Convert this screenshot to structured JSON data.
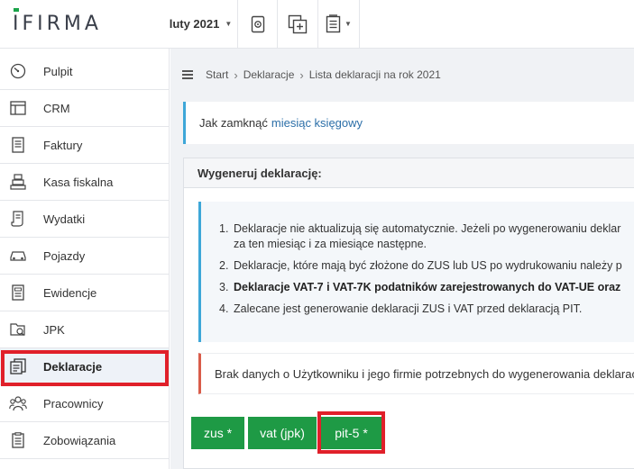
{
  "header": {
    "logo_prefix": "I",
    "logo_rest": "FIRMA",
    "month_label": "luty 2021",
    "toolbar_icons": [
      "register-icon",
      "add-document-icon",
      "document-list-icon"
    ]
  },
  "sidebar": {
    "items": [
      {
        "label": "Pulpit",
        "icon": "dashboard-icon"
      },
      {
        "label": "CRM",
        "icon": "crm-icon"
      },
      {
        "label": "Faktury",
        "icon": "invoice-icon"
      },
      {
        "label": "Kasa fiskalna",
        "icon": "cash-register-icon"
      },
      {
        "label": "Wydatki",
        "icon": "expenses-icon"
      },
      {
        "label": "Pojazdy",
        "icon": "car-icon"
      },
      {
        "label": "Ewidencje",
        "icon": "records-icon"
      },
      {
        "label": "JPK",
        "icon": "jpk-icon"
      },
      {
        "label": "Deklaracje",
        "icon": "declarations-icon",
        "active": true
      },
      {
        "label": "Pracownicy",
        "icon": "employees-icon"
      },
      {
        "label": "Zobowiązania",
        "icon": "liabilities-icon"
      }
    ]
  },
  "breadcrumb": {
    "items": [
      "Start",
      "Deklaracje",
      "Lista deklaracji na rok 2021"
    ]
  },
  "info": {
    "text": "Jak zamknąć",
    "link": "miesiąc księgowy"
  },
  "panel": {
    "title": "Wygeneruj deklarację:",
    "list": [
      {
        "num": "1.",
        "line1": "Deklaracje nie aktualizują się automatycznie. Jeżeli po wygenerowaniu deklar",
        "line2": "za ten miesiąc i za miesiące następne."
      },
      {
        "num": "2.",
        "text": "Deklaracje, które mają być złożone do ZUS lub US po wydrukowaniu należy p"
      },
      {
        "num": "3.",
        "bold": "Deklaracje VAT-7 i VAT-7K podatników zarejestrowanych do VAT-UE oraz"
      },
      {
        "num": "4.",
        "text": "Zalecane jest generowanie deklaracji ZUS i VAT przed deklaracją PIT."
      }
    ],
    "warning": "Brak danych o Użytkowniku i jego firmie potrzebnych do wygenerowania deklaracji"
  },
  "buttons": {
    "zus": "zus *",
    "vat": "vat (jpk)",
    "pit": "pit-5 *"
  },
  "colors": {
    "accent_green": "#1e9a45",
    "highlight_red": "#e0202a",
    "info_blue": "#3ea7d8",
    "warning_red": "#d95c4a"
  }
}
